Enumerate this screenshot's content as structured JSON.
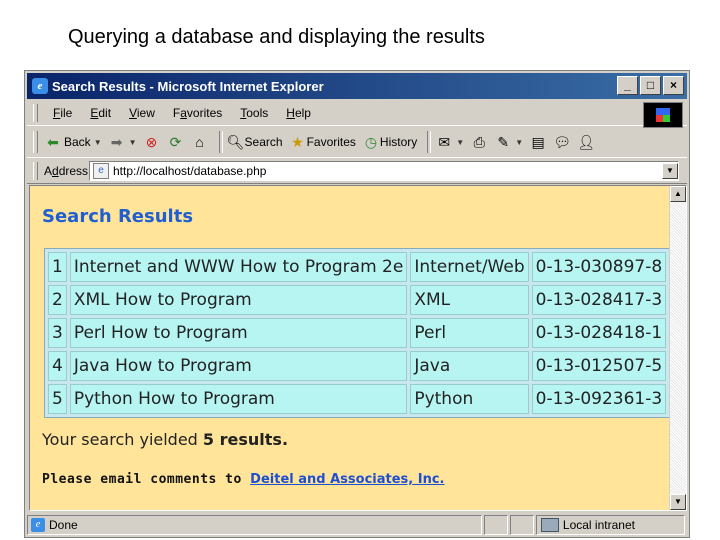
{
  "slide": {
    "title": "Querying a database and displaying the results"
  },
  "window": {
    "title": "Search Results - Microsoft Internet Explorer",
    "buttons": {
      "minimize": "_",
      "maximize": "□",
      "close": "×"
    }
  },
  "menu": [
    {
      "accel": "F",
      "rest": "ile"
    },
    {
      "accel": "E",
      "rest": "dit"
    },
    {
      "accel": "V",
      "rest": "iew"
    },
    {
      "accel": "F",
      "rest": "avorites",
      "prefix": ""
    },
    {
      "accel": "T",
      "rest": "ools"
    },
    {
      "accel": "H",
      "rest": "elp"
    }
  ],
  "toolbar": {
    "back": "Back",
    "search": "Search",
    "favorites": "Favorites",
    "history": "History"
  },
  "address": {
    "label_accel": "d",
    "label_pre": "A",
    "label_post": "dress",
    "url": "http://localhost/database.php"
  },
  "page": {
    "heading": "Search Results",
    "rows": [
      [
        "1",
        "Internet and WWW How to Program 2e",
        "Internet/Web",
        "0-13-030897-8"
      ],
      [
        "2",
        "XML How to Program",
        "XML",
        "0-13-028417-3"
      ],
      [
        "3",
        "Perl How to Program",
        "Perl",
        "0-13-028418-1"
      ],
      [
        "4",
        "Java How to Program",
        "Java",
        "0-13-012507-5"
      ],
      [
        "5",
        "Python How to Program",
        "Python",
        "0-13-092361-3"
      ]
    ],
    "yield_pre": "Your search yielded ",
    "yield_bold": "5 results.",
    "email_pre": "Please email comments to ",
    "email_link": "Deitel and Associates, Inc."
  },
  "status": {
    "text": "Done",
    "zone": "Local intranet"
  }
}
